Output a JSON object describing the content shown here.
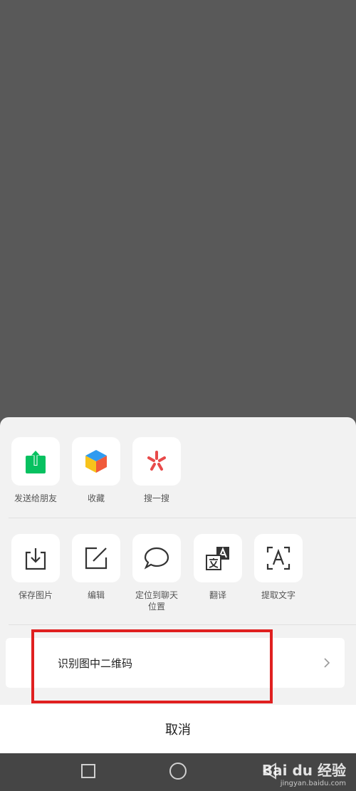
{
  "share_row": [
    {
      "label": "发送给朋友",
      "icon": "share-to-friend-icon"
    },
    {
      "label": "收藏",
      "icon": "favorites-cube-icon"
    },
    {
      "label": "搜一搜",
      "icon": "search-star-icon"
    }
  ],
  "tools_row": [
    {
      "label": "保存图片",
      "icon": "save-download-icon"
    },
    {
      "label": "编辑",
      "icon": "edit-pencil-icon"
    },
    {
      "label": "定位到聊天\n位置",
      "icon": "chat-bubble-icon"
    },
    {
      "label": "翻译",
      "icon": "translate-icon"
    },
    {
      "label": "提取文字",
      "icon": "extract-text-icon"
    }
  ],
  "qr": {
    "label": "识别图中二维码"
  },
  "cancel": {
    "label": "取消"
  },
  "watermark": {
    "main": "Bai du 经验",
    "sub": "jingyan.baidu.com"
  },
  "colors": {
    "share_green": "#07c160",
    "highlight_red": "#e02020",
    "sheet_bg": "#f2f2f2",
    "dim_overlay": "#595959"
  }
}
